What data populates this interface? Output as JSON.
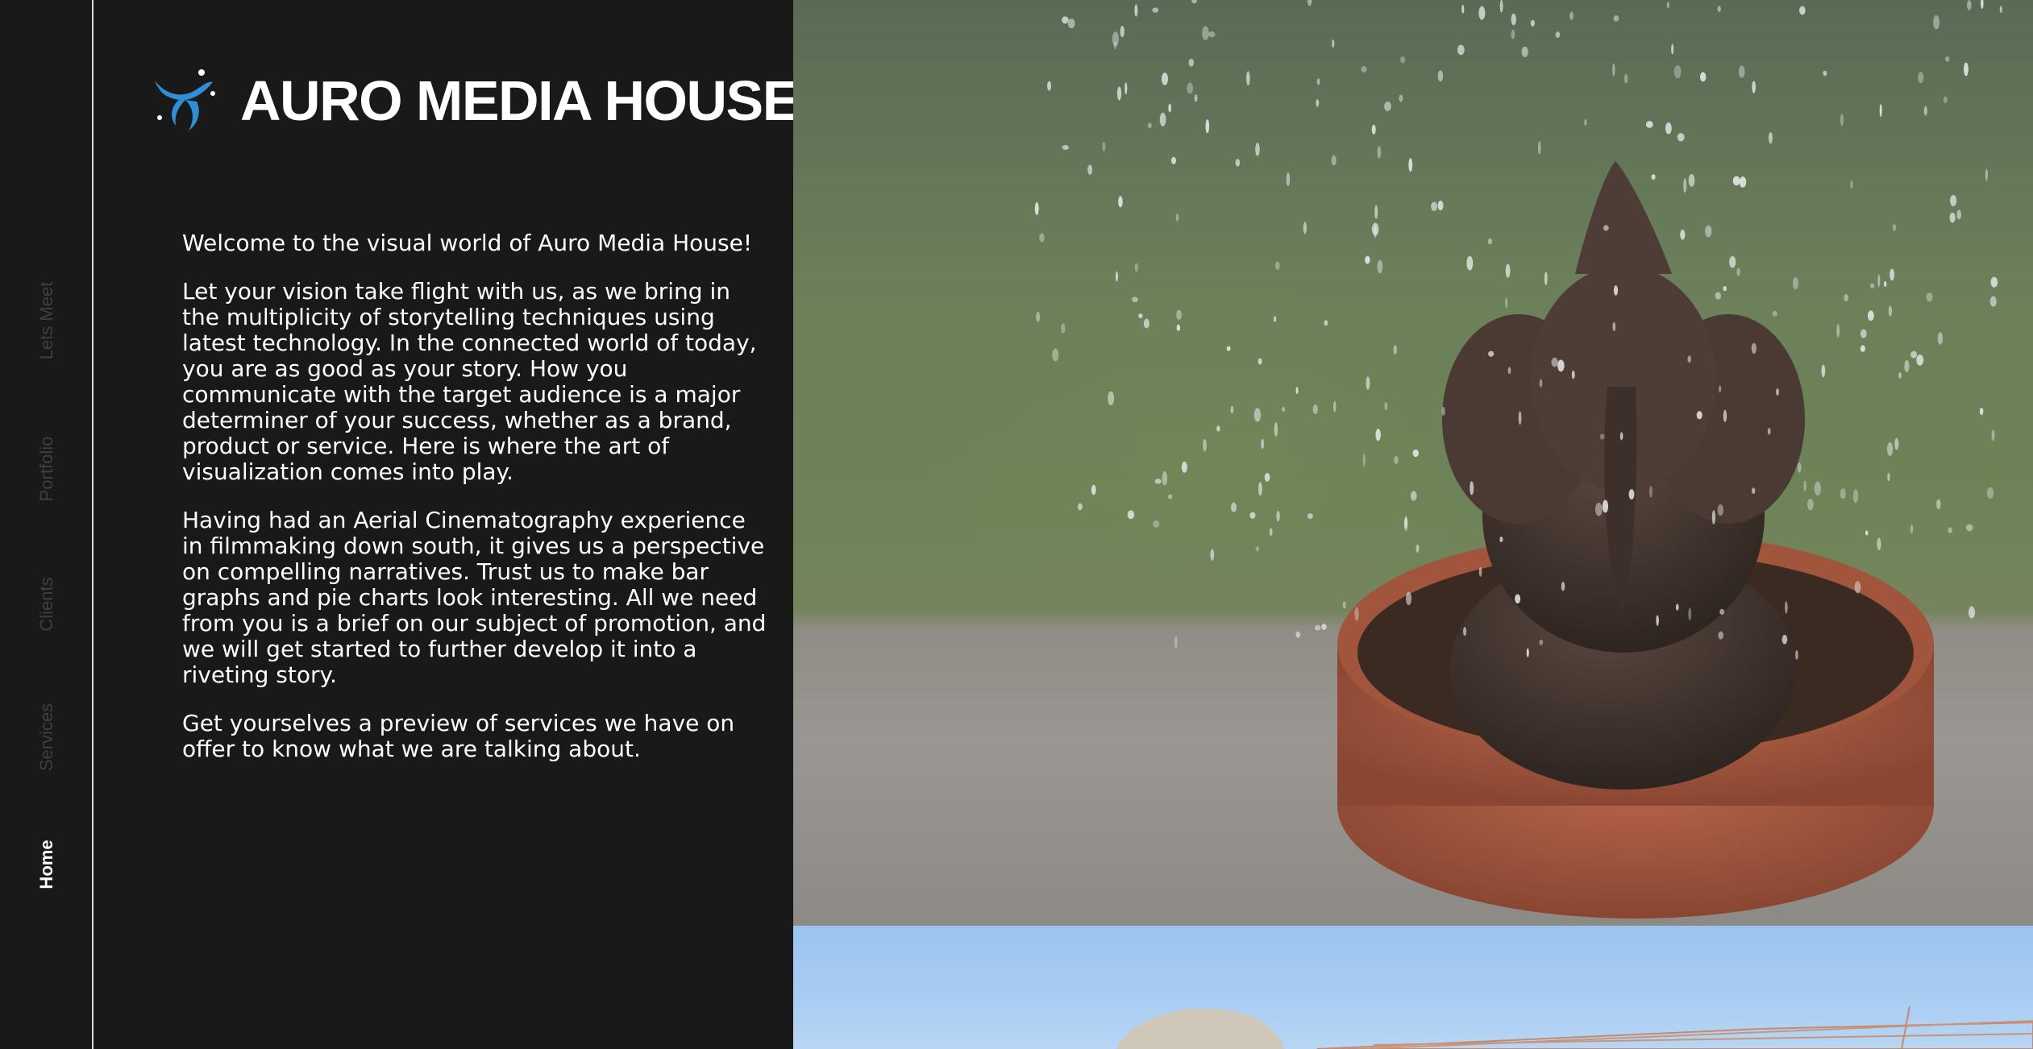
{
  "nav": {
    "items": [
      {
        "label": "Lets Meet",
        "active": false
      },
      {
        "label": "Portfolio",
        "active": false
      },
      {
        "label": "Clients",
        "active": false
      },
      {
        "label": "Services",
        "active": false
      },
      {
        "label": "Home",
        "active": true
      }
    ]
  },
  "brand": {
    "name": "AURO MEDIA HOUSE",
    "logo_icon": "swirl-logo-icon",
    "logo_color": "#2f8fd6"
  },
  "intro": {
    "paragraphs": [
      "Welcome to the visual world of Auro Media House!",
      "Let your vision take flight with us, as we bring in the multiplicity of storytelling techniques using latest technology. In the connected world of today, you are as good as your story. How you communicate with the target audience is a major determiner of your success, whether as a brand, product or service. Here is where the art of visualization comes into play.",
      "Having had an Aerial Cinematography experience in filmmaking down south, it gives us a perspective on compelling narratives. Trust us to make bar graphs and pie charts look interesting. All we need from you is a brief on our subject of promotion, and we will get started to further develop it into a riveting story.",
      "Get yourselves a preview of services we have on offer to know what we are talking about."
    ]
  },
  "colors": {
    "background": "#191919",
    "text": "#ffffff",
    "nav_inactive": "#3f3f3f",
    "rail_border": "#d8d8d8"
  }
}
